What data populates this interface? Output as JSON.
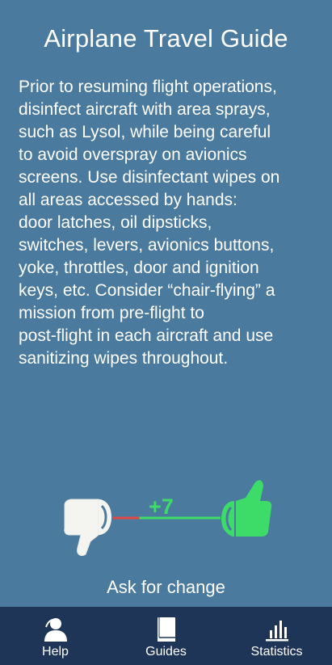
{
  "header": {
    "title": "Airplane Travel Guide"
  },
  "guide": {
    "text": "Prior to resuming flight operations,\ndisinfect aircraft with area sprays,\nsuch as Lysol, while being careful\nto avoid overspray on avionics\nscreens. Use disinfectant wipes on\nall areas accessed by hands:\ndoor latches, oil dipsticks,\nswitches, levers, avionics buttons,\nyoke, throttles, door and ignition\nkeys, etc. Consider “chair-flying” a\nmission from pre-flight to\npost-flight in each aircraft and use\nsanitizing wipes throughout."
  },
  "vote": {
    "score": "+7",
    "positive_share": 0.75,
    "colors": {
      "positive": "#3ddc68",
      "negative": "#e04848",
      "neutral": "#f4f4f1"
    },
    "ask_label": "Ask for change"
  },
  "nav": {
    "items": [
      {
        "label": "Help",
        "icon": "help-person-icon"
      },
      {
        "label": "Guides",
        "icon": "book-icon"
      },
      {
        "label": "Statistics",
        "icon": "bar-chart-icon"
      }
    ]
  }
}
